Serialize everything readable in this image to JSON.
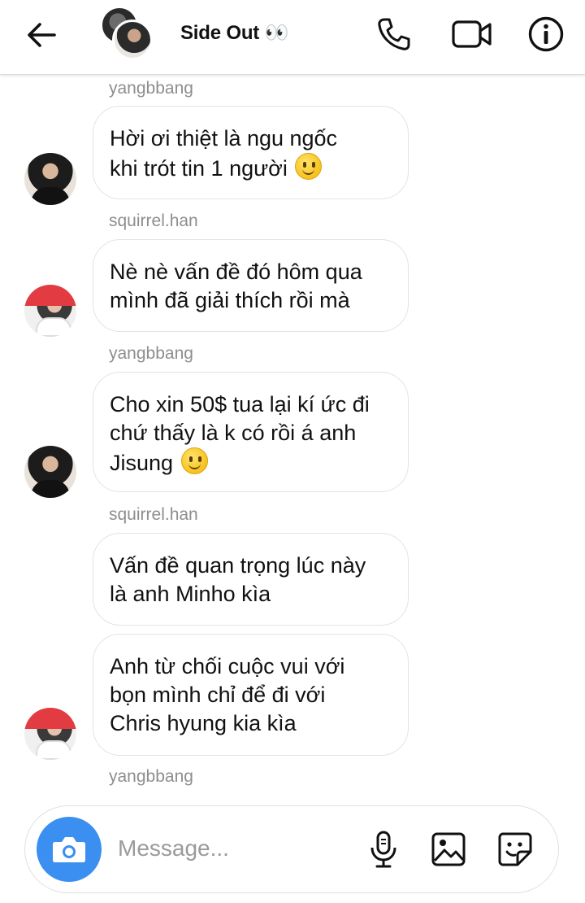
{
  "header": {
    "title": "Side Out 👀",
    "back_icon": "arrow-left-icon",
    "call_icon": "phone-icon",
    "video_icon": "video-camera-icon",
    "info_icon": "info-icon"
  },
  "messages": [
    {
      "sender": "yangbbang",
      "lines": [
        "Hời ơi thiệt là ngu ngốc",
        "khi trót tin 1 người"
      ],
      "emoji": "slightly-smiling-face",
      "avatar": "yangbbang"
    },
    {
      "sender": "squirrel.han",
      "lines": [
        "Nè nè vấn đề đó hôm qua",
        "mình đã giải thích rồi mà"
      ],
      "avatar": "squirrel.han"
    },
    {
      "sender": "yangbbang",
      "lines": [
        "Cho xin 50$ tua lại kí ức đi",
        "chứ thấy là k có rồi á anh",
        "Jisung"
      ],
      "emoji": "slightly-smiling-face",
      "avatar": "yangbbang"
    },
    {
      "sender": "squirrel.han",
      "lines": [
        "Vấn đề quan trọng lúc này",
        "là anh Minho kìa"
      ]
    },
    {
      "lines": [
        "Anh từ chối cuộc vui với",
        "bọn mình chỉ để đi với",
        "Chris hyung kia kìa"
      ],
      "avatar": "squirrel.han"
    },
    {
      "sender": "yangbbang"
    }
  ],
  "composer": {
    "placeholder": "Message...",
    "camera_icon": "camera-icon",
    "mic_icon": "microphone-icon",
    "gallery_icon": "image-icon",
    "sticker_icon": "sticker-icon"
  },
  "colors": {
    "accent": "#3b8ff0",
    "sender_label": "#8e8e8e",
    "bubble_border": "#e3e3e3"
  }
}
